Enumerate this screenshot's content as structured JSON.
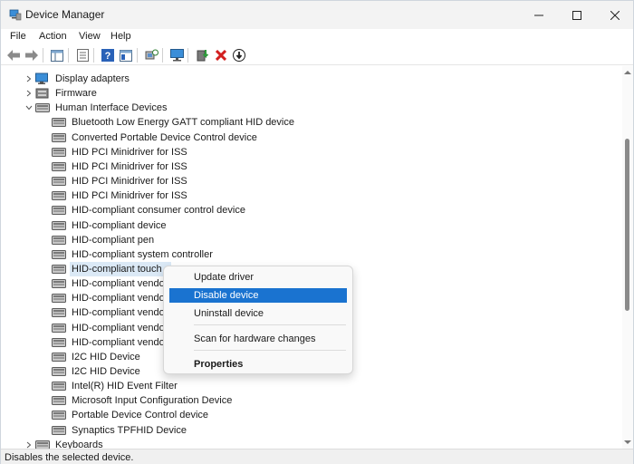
{
  "window": {
    "title": "Device Manager",
    "icon": "device-manager-icon"
  },
  "menubar": {
    "items": [
      "File",
      "Action",
      "View",
      "Help"
    ]
  },
  "toolbar": {
    "buttons": [
      "back-arrow-icon",
      "forward-arrow-icon",
      "properties-pane-icon",
      "properties-sheet-icon",
      "help-icon",
      "console-tree-icon",
      "scan-hardware-icon",
      "monitor-icon",
      "update-driver-icon",
      "uninstall-x-icon",
      "disable-down-arrow-icon"
    ]
  },
  "tree": {
    "categories_top": [
      {
        "label": "Display adapters",
        "state": "collapsed"
      },
      {
        "label": "Firmware",
        "state": "collapsed"
      },
      {
        "label": "Human Interface Devices",
        "state": "expanded"
      }
    ],
    "hid_children": [
      "Bluetooth Low Energy GATT compliant HID device",
      "Converted Portable Device Control device",
      "HID PCI Minidriver for ISS",
      "HID PCI Minidriver for ISS",
      "HID PCI Minidriver for ISS",
      "HID PCI Minidriver for ISS",
      "HID-compliant consumer control device",
      "HID-compliant device",
      "HID-compliant pen",
      "HID-compliant system controller",
      "HID-compliant touch s",
      "HID-compliant vendo",
      "HID-compliant vendo",
      "HID-compliant vendo",
      "HID-compliant vendo",
      "HID-compliant vendo",
      "I2C HID Device",
      "I2C HID Device",
      "Intel(R) HID Event Filter",
      "Microsoft Input Configuration Device",
      "Portable Device Control device",
      "Synaptics TPFHID Device"
    ],
    "categories_bottom": [
      {
        "label": "Keyboards",
        "state": "collapsed"
      }
    ],
    "selected_index": 10
  },
  "context_menu": {
    "items": [
      {
        "label": "Update driver",
        "highlighted": false,
        "bold": false
      },
      {
        "label": "Disable device",
        "highlighted": true,
        "bold": false
      },
      {
        "label": "Uninstall device",
        "highlighted": false,
        "bold": false
      },
      {
        "label": "Scan for hardware changes",
        "highlighted": false,
        "bold": false
      },
      {
        "label": "Properties",
        "highlighted": false,
        "bold": true
      }
    ]
  },
  "status": {
    "text": "Disables the selected device."
  },
  "colors": {
    "accent": "#1a73d0",
    "selection": "#dbe9f6"
  }
}
